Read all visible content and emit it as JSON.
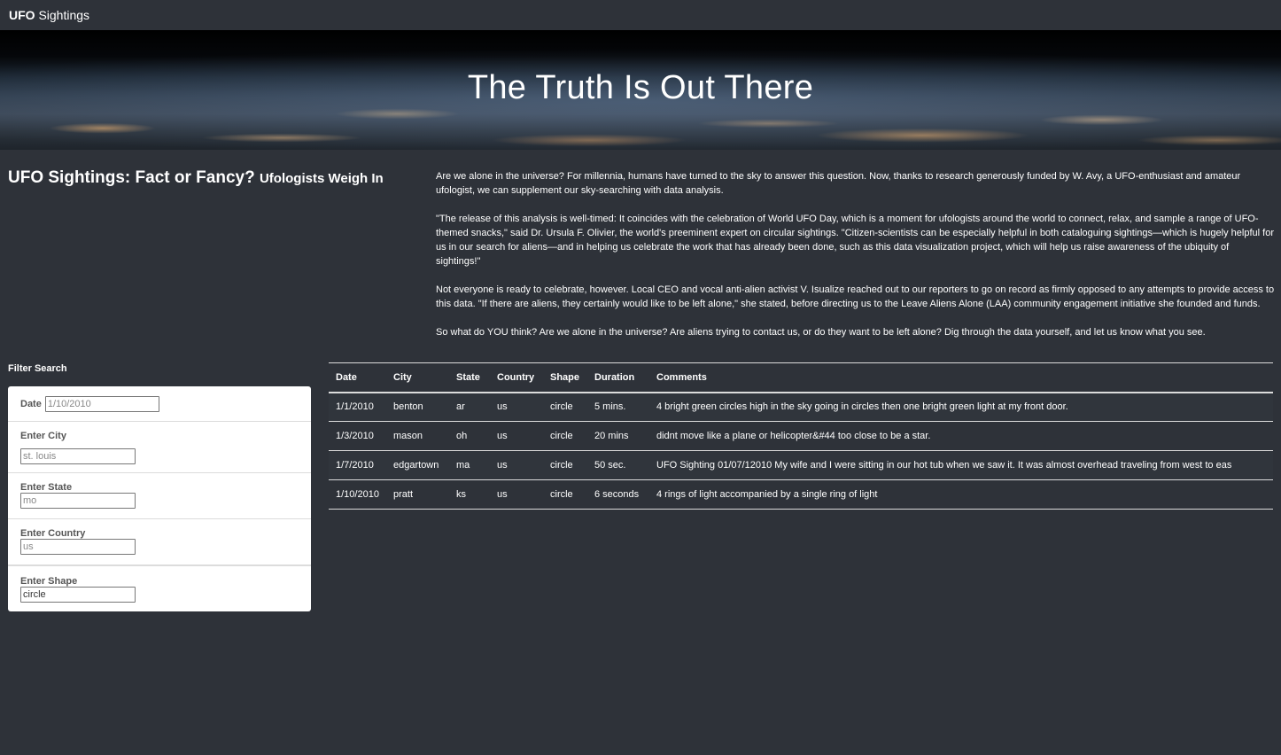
{
  "navbar": {
    "brand_strong": "UFO",
    "brand_rest": " Sightings"
  },
  "hero": {
    "title": "The Truth Is Out There"
  },
  "intro": {
    "heading": "UFO Sightings: Fact or Fancy?",
    "subheading": "Ufologists Weigh In",
    "paragraphs": [
      "Are we alone in the universe? For millennia, humans have turned to the sky to answer this question. Now, thanks to research generously funded by W. Avy, a UFO-enthusiast and amateur ufologist, we can supplement our sky-searching with data analysis.",
      "\"The release of this analysis is well-timed: It coincides with the celebration of World UFO Day, which is a moment for ufologists around the world to connect, relax, and sample a range of UFO-themed snacks,\" said Dr. Ursula F. Olivier, the world's preeminent expert on circular sightings. \"Citizen-scientists can be especially helpful in both cataloguing sightings—which is hugely helpful for us in our search for aliens—and in helping us celebrate the work that has already been done, such as this data visualization project, which will help us raise awareness of the ubiquity of sightings!\"",
      "Not everyone is ready to celebrate, however. Local CEO and vocal anti-alien activist V. Isualize reached out to our reporters to go on record as firmly opposed to any attempts to provide access to this data. \"If there are aliens, they certainly would like to be left alone,\" she stated, before directing us to the Leave Aliens Alone (LAA) community engagement initiative she founded and funds.",
      "So what do YOU think? Are we alone in the universe? Are aliens trying to contact us, or do they want to be left alone? Dig through the data yourself, and let us know what you see."
    ]
  },
  "filters": {
    "title": "Filter Search",
    "date": {
      "label": "Date",
      "placeholder": "1/10/2010",
      "value": ""
    },
    "city": {
      "label": "Enter City",
      "placeholder": "st. louis",
      "value": ""
    },
    "state": {
      "label": "Enter State",
      "placeholder": "mo",
      "value": ""
    },
    "country": {
      "label": "Enter Country",
      "placeholder": "us",
      "value": ""
    },
    "shape": {
      "label": "Enter Shape",
      "placeholder": "",
      "value": "circle"
    }
  },
  "table": {
    "headers": [
      "Date",
      "City",
      "State",
      "Country",
      "Shape",
      "Duration",
      "Comments"
    ],
    "rows": [
      [
        "1/1/2010",
        "benton",
        "ar",
        "us",
        "circle",
        "5 mins.",
        "4 bright green circles high in the sky going in circles then one bright green light at my front door."
      ],
      [
        "1/3/2010",
        "mason",
        "oh",
        "us",
        "circle",
        "20 mins",
        "didnt move like a plane or helicopter&#44 too close to be a star."
      ],
      [
        "1/7/2010",
        "edgartown",
        "ma",
        "us",
        "circle",
        "50 sec.",
        "UFO Sighting 01/07/12010 My wife and I were sitting in our hot tub when we saw it. It was almost overhead traveling from west to eas"
      ],
      [
        "1/10/2010",
        "pratt",
        "ks",
        "us",
        "circle",
        "6 seconds",
        "4 rings of light accompanied by a single ring of light"
      ]
    ]
  }
}
